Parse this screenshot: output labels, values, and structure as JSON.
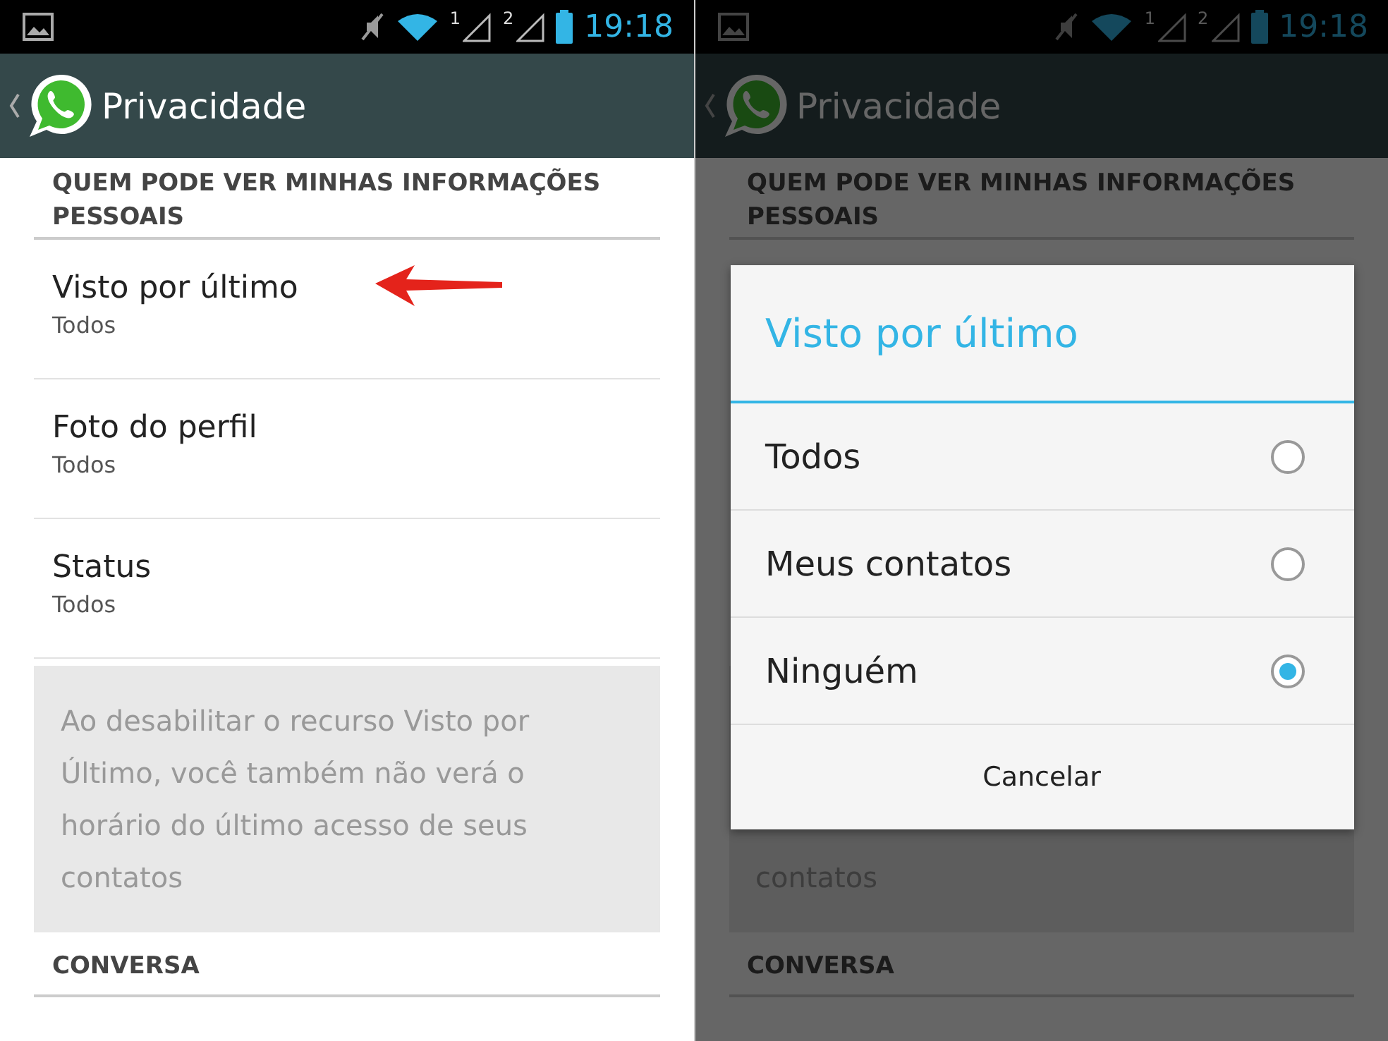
{
  "screens": [
    {
      "status_bar": {
        "sims": [
          "1",
          "2"
        ],
        "time": "19:18"
      },
      "header": {
        "title": "Privacidade"
      },
      "dimmed": false,
      "section": {
        "title": "QUEM PODE VER MINHAS INFORMAÇÕES PESSOAIS",
        "items": [
          {
            "label": "Visto por último",
            "value": "Todos",
            "pointed": true
          },
          {
            "label": "Foto do perfil",
            "value": "Todos",
            "pointed": false
          },
          {
            "label": "Status",
            "value": "Todos",
            "pointed": false
          }
        ],
        "note": "Ao desabilitar o recurso Visto por Último, você também não verá o horário do último acesso de seus contatos"
      },
      "next_section": {
        "title": "CONVERSA"
      }
    },
    {
      "status_bar": {
        "sims": [
          "1",
          "2"
        ],
        "time": "19:18"
      },
      "header": {
        "title": "Privacidade"
      },
      "dimmed": true,
      "section": {
        "title": "QUEM PODE VER MINHAS INFORMAÇÕES PESSOAIS",
        "note": "contatos"
      },
      "next_section": {
        "title": "CONVERSA"
      },
      "dialog": {
        "title": "Visto por último",
        "options": [
          {
            "label": "Todos",
            "selected": false
          },
          {
            "label": "Meus contatos",
            "selected": false
          },
          {
            "label": "Ninguém",
            "selected": true
          }
        ],
        "cancel": "Cancelar"
      }
    }
  ]
}
